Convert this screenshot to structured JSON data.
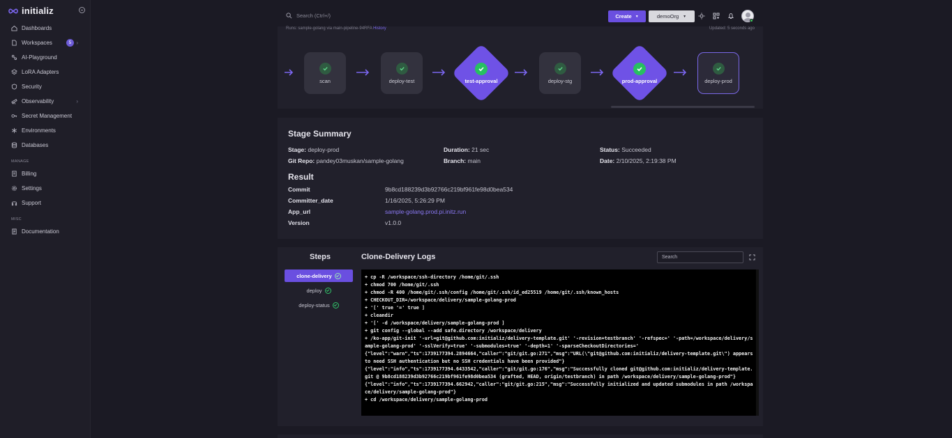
{
  "app": {
    "brand": "initializ"
  },
  "sidebar": {
    "items": [
      {
        "label": "Dashboards",
        "icon": "home-icon"
      },
      {
        "label": "Workspaces",
        "icon": "file-icon",
        "badge": "5",
        "chevron": true
      },
      {
        "label": "AI-Playground",
        "icon": "ai-icon"
      },
      {
        "label": "LoRA Adapters",
        "icon": "layers-icon"
      },
      {
        "label": "Security",
        "icon": "shield-icon"
      },
      {
        "label": "Observability",
        "icon": "telescope-icon",
        "chevron": true
      },
      {
        "label": "Secret Management",
        "icon": "key-icon"
      },
      {
        "label": "Environments",
        "icon": "asterisk-icon"
      },
      {
        "label": "Databases",
        "icon": "database-icon"
      }
    ],
    "manage_heading": "MANAGE",
    "manage_items": [
      {
        "label": "Billing",
        "icon": "receipt-icon"
      },
      {
        "label": "Settings",
        "icon": "gear-icon"
      },
      {
        "label": "Support",
        "icon": "headset-icon"
      }
    ],
    "misc_heading": "MISC",
    "misc_items": [
      {
        "label": "Documentation",
        "icon": "document-icon"
      }
    ]
  },
  "topbar": {
    "search_placeholder": "Search (Ctrl+/)",
    "create_label": "Create",
    "org_label": "demoOrg"
  },
  "pipeline": {
    "meta_text": "Runs: sample-golang via main-pipeline-94RFA",
    "meta_link": "History",
    "updated_text": "Updated: 5 seconds ago",
    "stages": [
      {
        "name": "scan",
        "type": "task",
        "status": "succeeded"
      },
      {
        "name": "deploy-test",
        "type": "task",
        "status": "succeeded"
      },
      {
        "name": "test-approval",
        "type": "approval",
        "status": "succeeded"
      },
      {
        "name": "deploy-stg",
        "type": "task",
        "status": "succeeded"
      },
      {
        "name": "prod-approval",
        "type": "approval",
        "status": "succeeded"
      },
      {
        "name": "deploy-prod",
        "type": "task",
        "status": "succeeded",
        "selected": true
      }
    ]
  },
  "summary": {
    "title": "Stage Summary",
    "stage_label": "Stage:",
    "stage_value": "deploy-prod",
    "duration_label": "Duration:",
    "duration_value": "21 sec",
    "status_label": "Status:",
    "status_value": "Succeeded",
    "repo_label": "Git Repo:",
    "repo_value": "pandey03muskan/sample-golang",
    "branch_label": "Branch:",
    "branch_value": "main",
    "date_label": "Date:",
    "date_value": "2/10/2025, 2:19:38 PM"
  },
  "result": {
    "title": "Result",
    "rows": [
      {
        "key": "Commit",
        "value": "9b8cd188239d3b92766c219bf961fe98d0bea534",
        "link": false
      },
      {
        "key": "Committer_date",
        "value": "1/16/2025, 5:26:29 PM",
        "link": false
      },
      {
        "key": "App_url",
        "value": "sample-golang.prod.pi.initz.run",
        "link": true
      },
      {
        "key": "Version",
        "value": "v1.0.0",
        "link": false
      }
    ]
  },
  "steps": {
    "title": "Steps",
    "items": [
      {
        "label": "clone-delivery",
        "active": true
      },
      {
        "label": "deploy",
        "active": false
      },
      {
        "label": "deploy-status",
        "active": false
      }
    ]
  },
  "logs": {
    "title": "Clone-Delivery Logs",
    "search_placeholder": "Search",
    "lines": [
      "+ cp -R /workspace/ssh-directory /home/git/.ssh",
      "+ chmod 700 /home/git/.ssh",
      "+ chmod -R 400 /home/git/.ssh/config /home/git/.ssh/id_ed25519 /home/git/.ssh/known_hosts",
      "+ CHECKOUT_DIR=/workspace/delivery/sample-golang-prod",
      "+ '[' true '=' true ]",
      "+ cleandir",
      "+ '[' -d /workspace/delivery/sample-golang-prod ]",
      "+ git config --global --add safe.directory /workspace/delivery",
      "+ /ko-app/git-init '-url=git@github.com:initializ/delivery-template.git' '-revision=testbranch' '-refspec=' '-path=/workspace/delivery/sample-golang-prod' '-sslVerify=true' '-submodules=true' '-depth=1' '-sparseCheckoutDirectories='",
      "{\"level\":\"warn\",\"ts\":1739177394.2894664,\"caller\":\"git/git.go:271\",\"msg\":\"URL(\\\"git@github.com:initializ/delivery-template.git\\\") appears to need SSH authentication but no SSH credentials have been provided\"}",
      "{\"level\":\"info\",\"ts\":1739177394.6433542,\"caller\":\"git/git.go:176\",\"msg\":\"Successfully cloned git@github.com:initializ/delivery-template.git @ 9b8cd188239d3b92766c219bf961fe98d0bea534 (grafted, HEAD, origin/testbranch) in path /workspace/delivery/sample-golang-prod\"}",
      "{\"level\":\"info\",\"ts\":1739177394.662942,\"caller\":\"git/git.go:215\",\"msg\":\"Successfully initialized and updated submodules in path /workspace/delivery/sample-golang-prod\"}",
      "+ cd /workspace/delivery/sample-golang-prod"
    ]
  },
  "colors": {
    "accent": "#6a4fe0",
    "success": "#27c061",
    "background": "#1b1a24",
    "panel": "#21202b"
  }
}
